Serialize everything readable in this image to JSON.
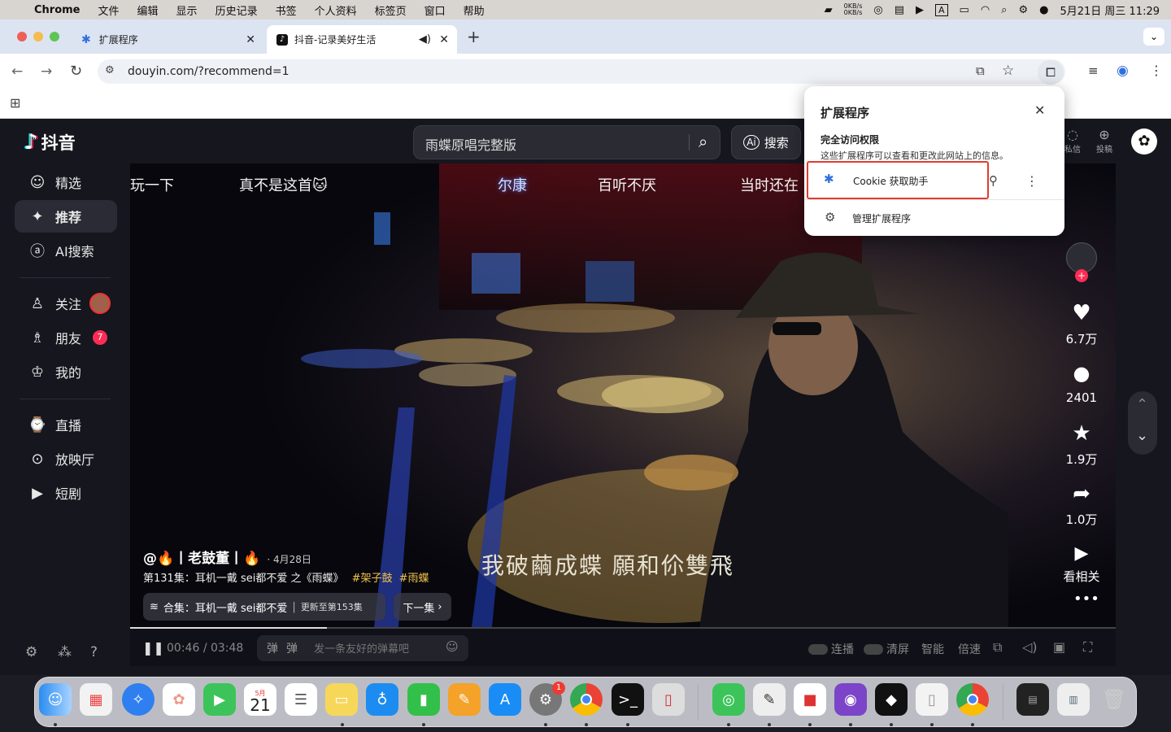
{
  "menubar": {
    "app": "Chrome",
    "items": [
      "文件",
      "编辑",
      "显示",
      "历史记录",
      "书签",
      "个人资料",
      "标签页",
      "窗口",
      "帮助"
    ],
    "net_up": "0KB/s",
    "net_down": "0KB/s",
    "input_method": "A",
    "datetime": "5月21日 周三 11:29"
  },
  "tabs": [
    {
      "title": "扩展程序"
    },
    {
      "title": "抖音-记录美好生活"
    }
  ],
  "address": {
    "url": "douyin.com/?recommend=1"
  },
  "douyin": {
    "logo": "抖音",
    "search_value": "雨蝶原唱完整版",
    "ai_search": "搜索",
    "top_right": [
      "私信",
      "投稿"
    ],
    "nav": [
      "精选",
      "推荐",
      "AI搜索",
      "关注",
      "朋友",
      "我的",
      "直播",
      "放映厅",
      "短剧"
    ],
    "friend_badge": "7",
    "danmaku": [
      "玩一下",
      "真不是这首🐱",
      "尔康",
      "百听不厌",
      "当时还在"
    ],
    "lyrics": "我破繭成蝶 願和伱雙飛",
    "author": "@🔥丨老鼓董丨🔥",
    "date": "· 4月28日",
    "desc": "第131集：耳机一戴 sei都不爱 之《雨蝶》",
    "tags": [
      "#架子鼓",
      "#雨蝶"
    ],
    "collection": "合集：耳机一戴 sei都不爱",
    "collection_update": "更新至第153集",
    "next_episode": "下一集",
    "progress": 0.2,
    "time_current": "00:46",
    "time_sep": "/",
    "time_total": "03:48",
    "danmaku_placeholder": "发一条友好的弹幕吧",
    "controls": [
      "连播",
      "清屏",
      "智能",
      "倍速"
    ],
    "likes": "6.7万",
    "comments": "2401",
    "favorites": "1.9万",
    "shares": "1.0万",
    "related": "看相关"
  },
  "ext_popup": {
    "title": "扩展程序",
    "section": "完全访问权限",
    "desc": "这些扩展程序可以查看和更改此网站上的信息。",
    "ext_name": "Cookie 获取助手",
    "manage": "管理扩展程序"
  },
  "dock": {
    "calendar_month": "5月",
    "calendar_day": "21",
    "badge": "1"
  }
}
